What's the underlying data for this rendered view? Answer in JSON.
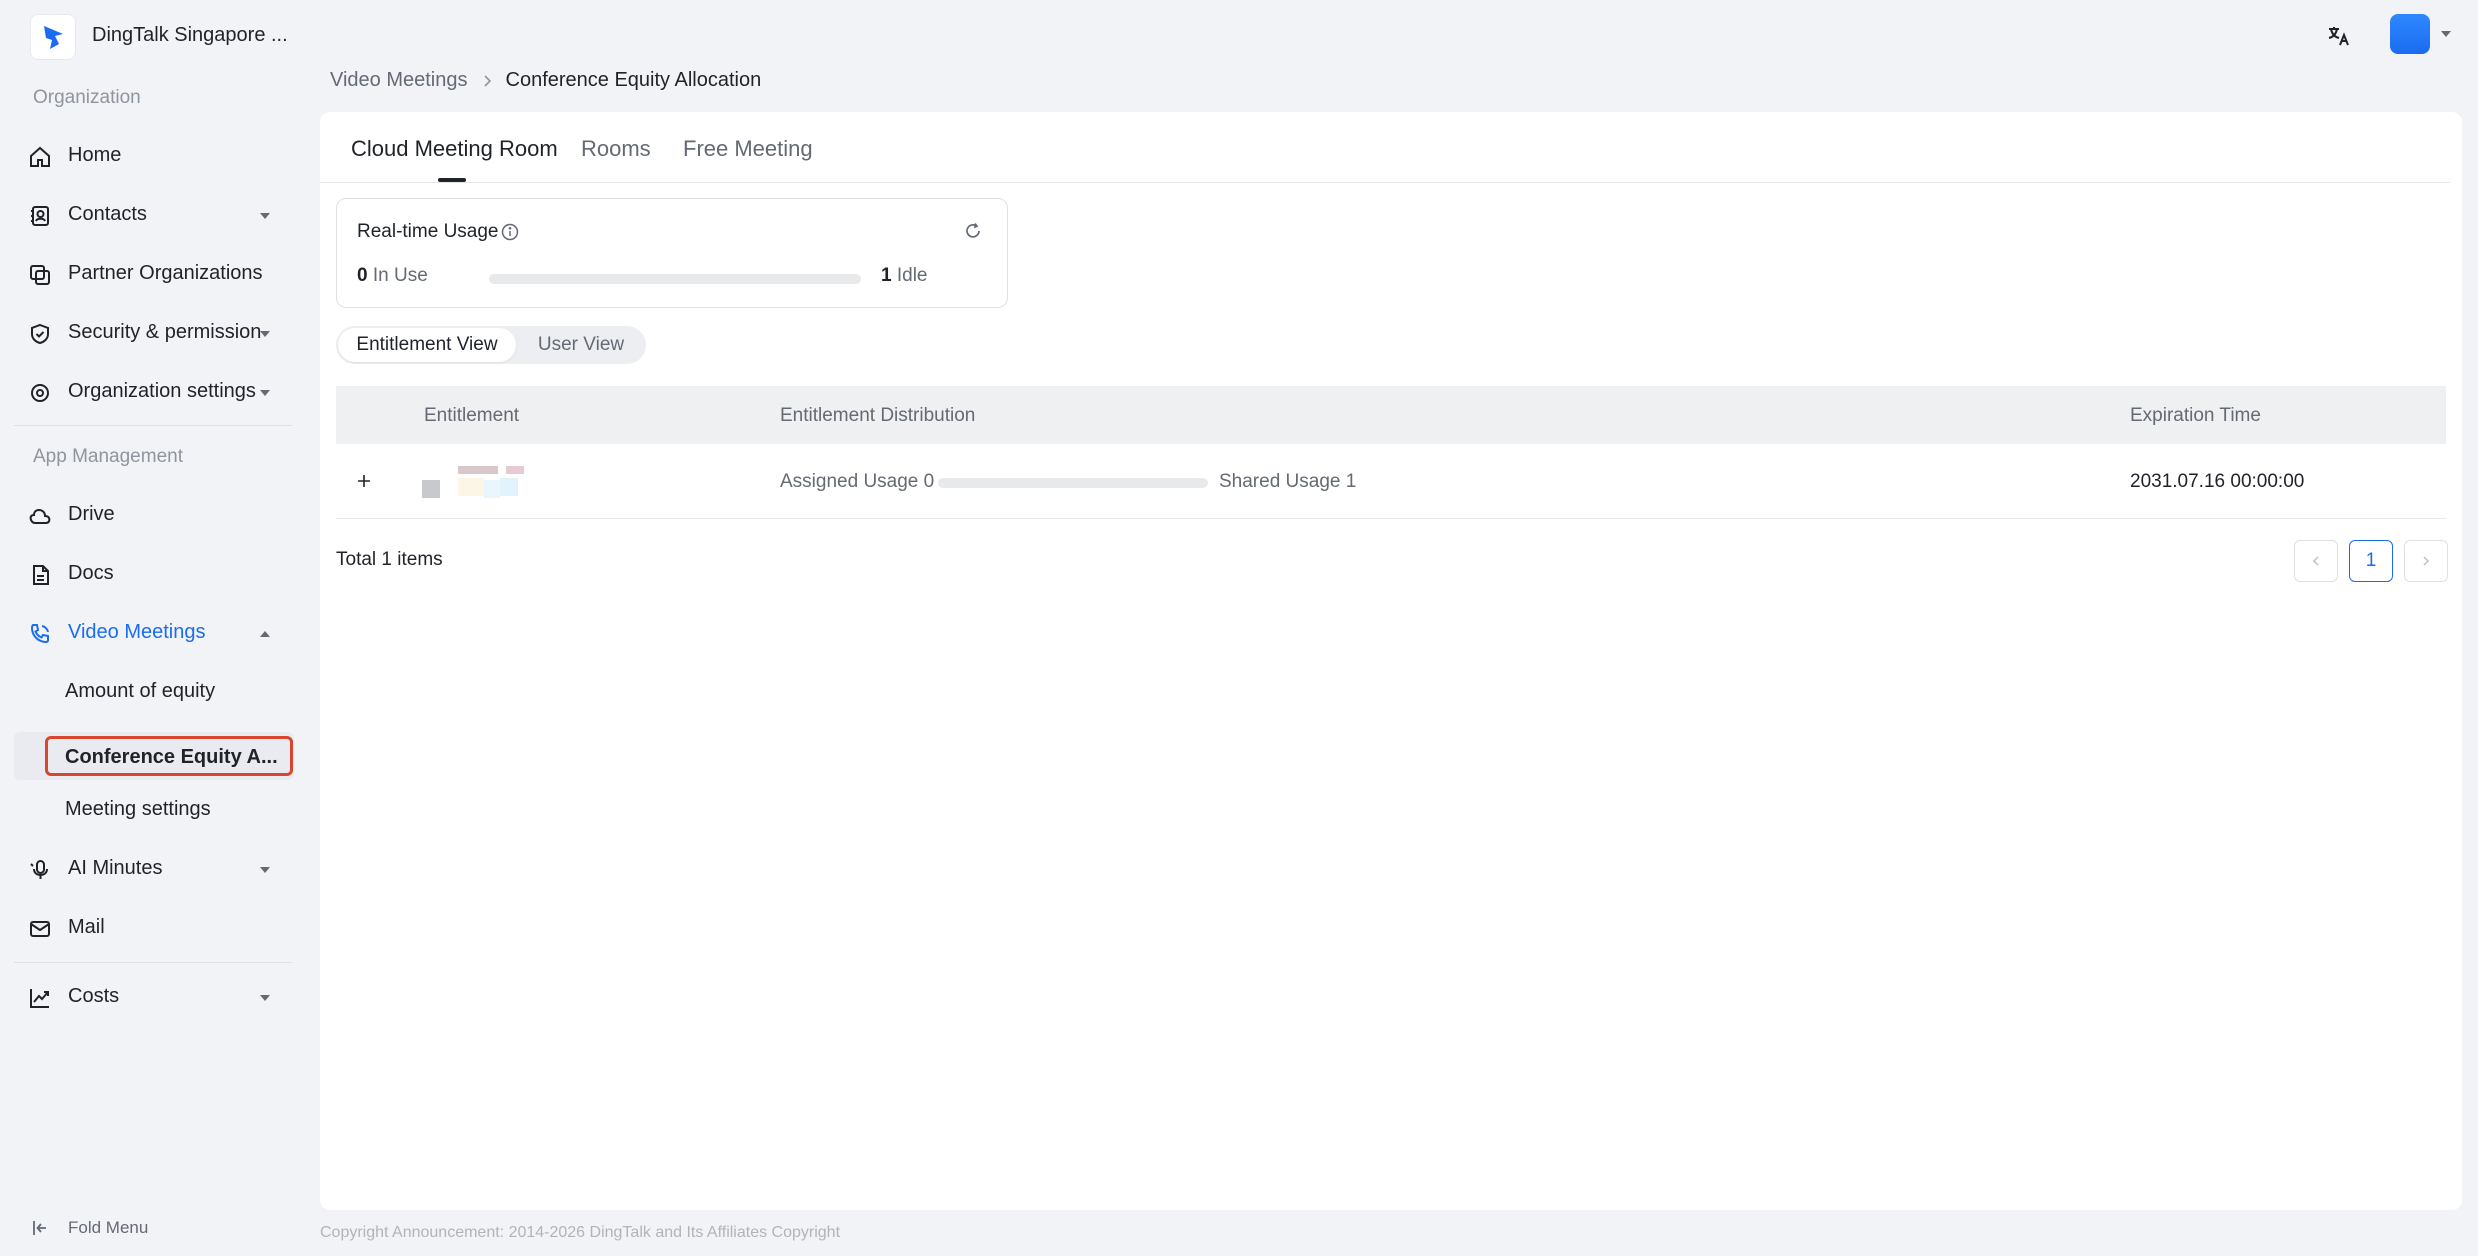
{
  "app": {
    "org_name": "DingTalk Singapore ...",
    "brand_color": "#1a6cf0"
  },
  "sidebar": {
    "section_org": "Organization",
    "section_apps": "App Management",
    "items": {
      "home": "Home",
      "contacts": "Contacts",
      "partner": "Partner Organizations",
      "security": "Security & permission",
      "org_settings": "Organization settings",
      "drive": "Drive",
      "docs": "Docs",
      "video_meetings": "Video Meetings",
      "amount_equity": "Amount of equity",
      "conference_equity": "Conference Equity A...",
      "meeting_settings": "Meeting settings",
      "ai_minutes": "AI Minutes",
      "mail": "Mail",
      "costs": "Costs"
    },
    "fold_menu": "Fold Menu"
  },
  "breadcrumb": {
    "parent": "Video Meetings",
    "current": "Conference Equity Allocation"
  },
  "tabs": {
    "cloud": "Cloud Meeting Room",
    "rooms": "Rooms",
    "free": "Free Meeting"
  },
  "usage": {
    "title": "Real-time Usage",
    "in_use_count": "0",
    "in_use_label": "In Use",
    "idle_count": "1",
    "idle_label": "Idle",
    "in_use_fraction": 0
  },
  "view_toggle": {
    "entitlement": "Entitlement View",
    "user": "User View"
  },
  "table": {
    "headers": {
      "entitlement": "Entitlement",
      "distribution": "Entitlement Distribution",
      "expiration": "Expiration Time"
    },
    "rows": [
      {
        "assigned": "Assigned Usage 0",
        "shared": "Shared Usage 1",
        "assigned_fraction": 0,
        "expiration": "2031.07.16 00:00:00"
      }
    ]
  },
  "pagination": {
    "total": "Total 1 items",
    "current": "1"
  },
  "footer": "Copyright Announcement: 2014-2026 DingTalk and Its Affiliates Copyright"
}
